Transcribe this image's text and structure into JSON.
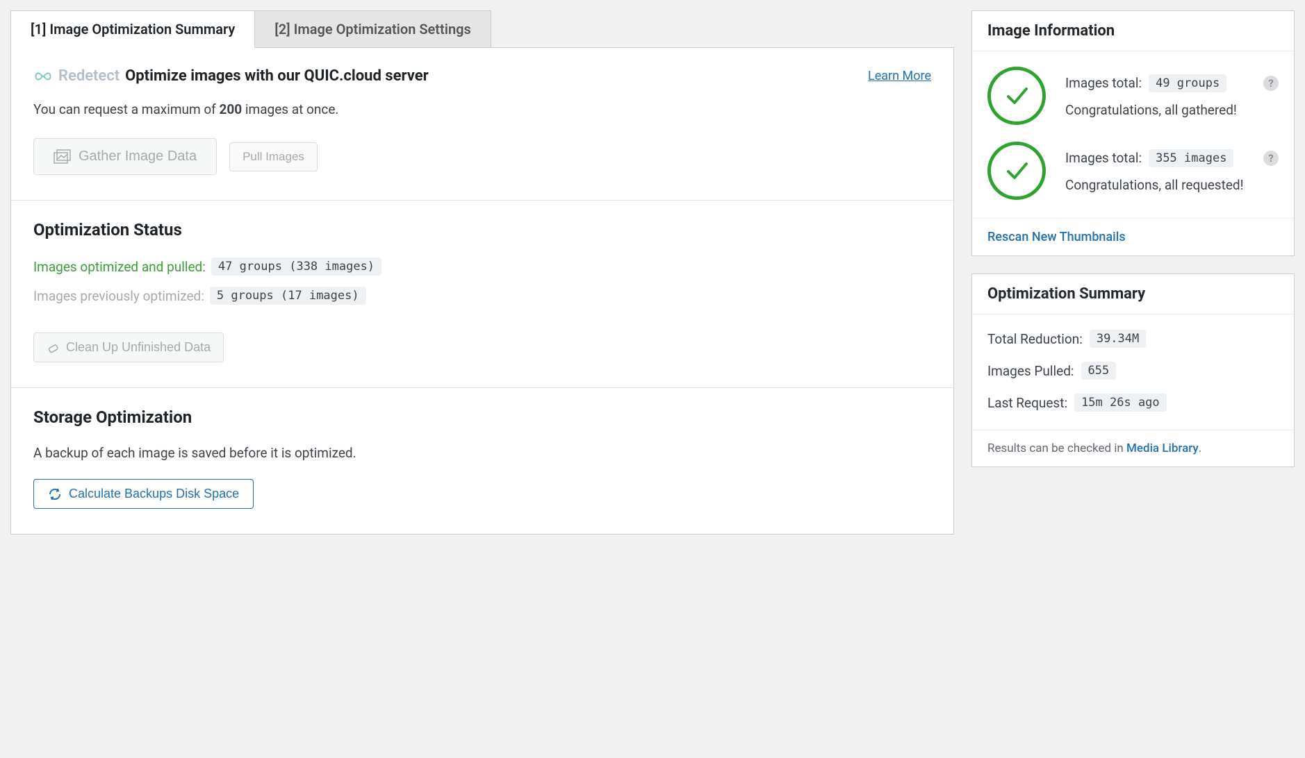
{
  "tabs": {
    "summary": "[1] Image Optimization Summary",
    "settings": "[2] Image Optimization Settings"
  },
  "main": {
    "redetect_label": "Redetect",
    "optimize_title": "Optimize images with our QUIC.cloud server",
    "learn_more": "Learn More",
    "max_prefix": "You can request a maximum of ",
    "max_count": "200",
    "max_suffix": " images at once.",
    "gather_btn": "Gather Image Data",
    "pull_btn": "Pull Images",
    "status_heading": "Optimization Status",
    "opt_pulled_label": "Images optimized and pulled:",
    "opt_pulled_value": "47 groups (338 images)",
    "prev_opt_label": "Images previously optimized:",
    "prev_opt_value": "5 groups (17 images)",
    "cleanup_btn": "Clean Up Unfinished Data",
    "storage_heading": "Storage Optimization",
    "storage_desc": "A backup of each image is saved before it is optimized.",
    "calc_btn": "Calculate Backups Disk Space"
  },
  "sidebar": {
    "info_heading": "Image Information",
    "groups": {
      "label": "Images total:",
      "value": "49 groups",
      "message": "Congratulations, all gathered!"
    },
    "images": {
      "label": "Images total:",
      "value": "355 images",
      "message": "Congratulations, all requested!"
    },
    "rescan": "Rescan New Thumbnails",
    "summary_heading": "Optimization Summary",
    "total_reduction_label": "Total Reduction:",
    "total_reduction_value": "39.34M",
    "images_pulled_label": "Images Pulled:",
    "images_pulled_value": "655",
    "last_request_label": "Last Request:",
    "last_request_value": "15m 26s ago",
    "results_text": "Results can be checked in ",
    "results_link": "Media Library",
    "results_dot": "."
  }
}
